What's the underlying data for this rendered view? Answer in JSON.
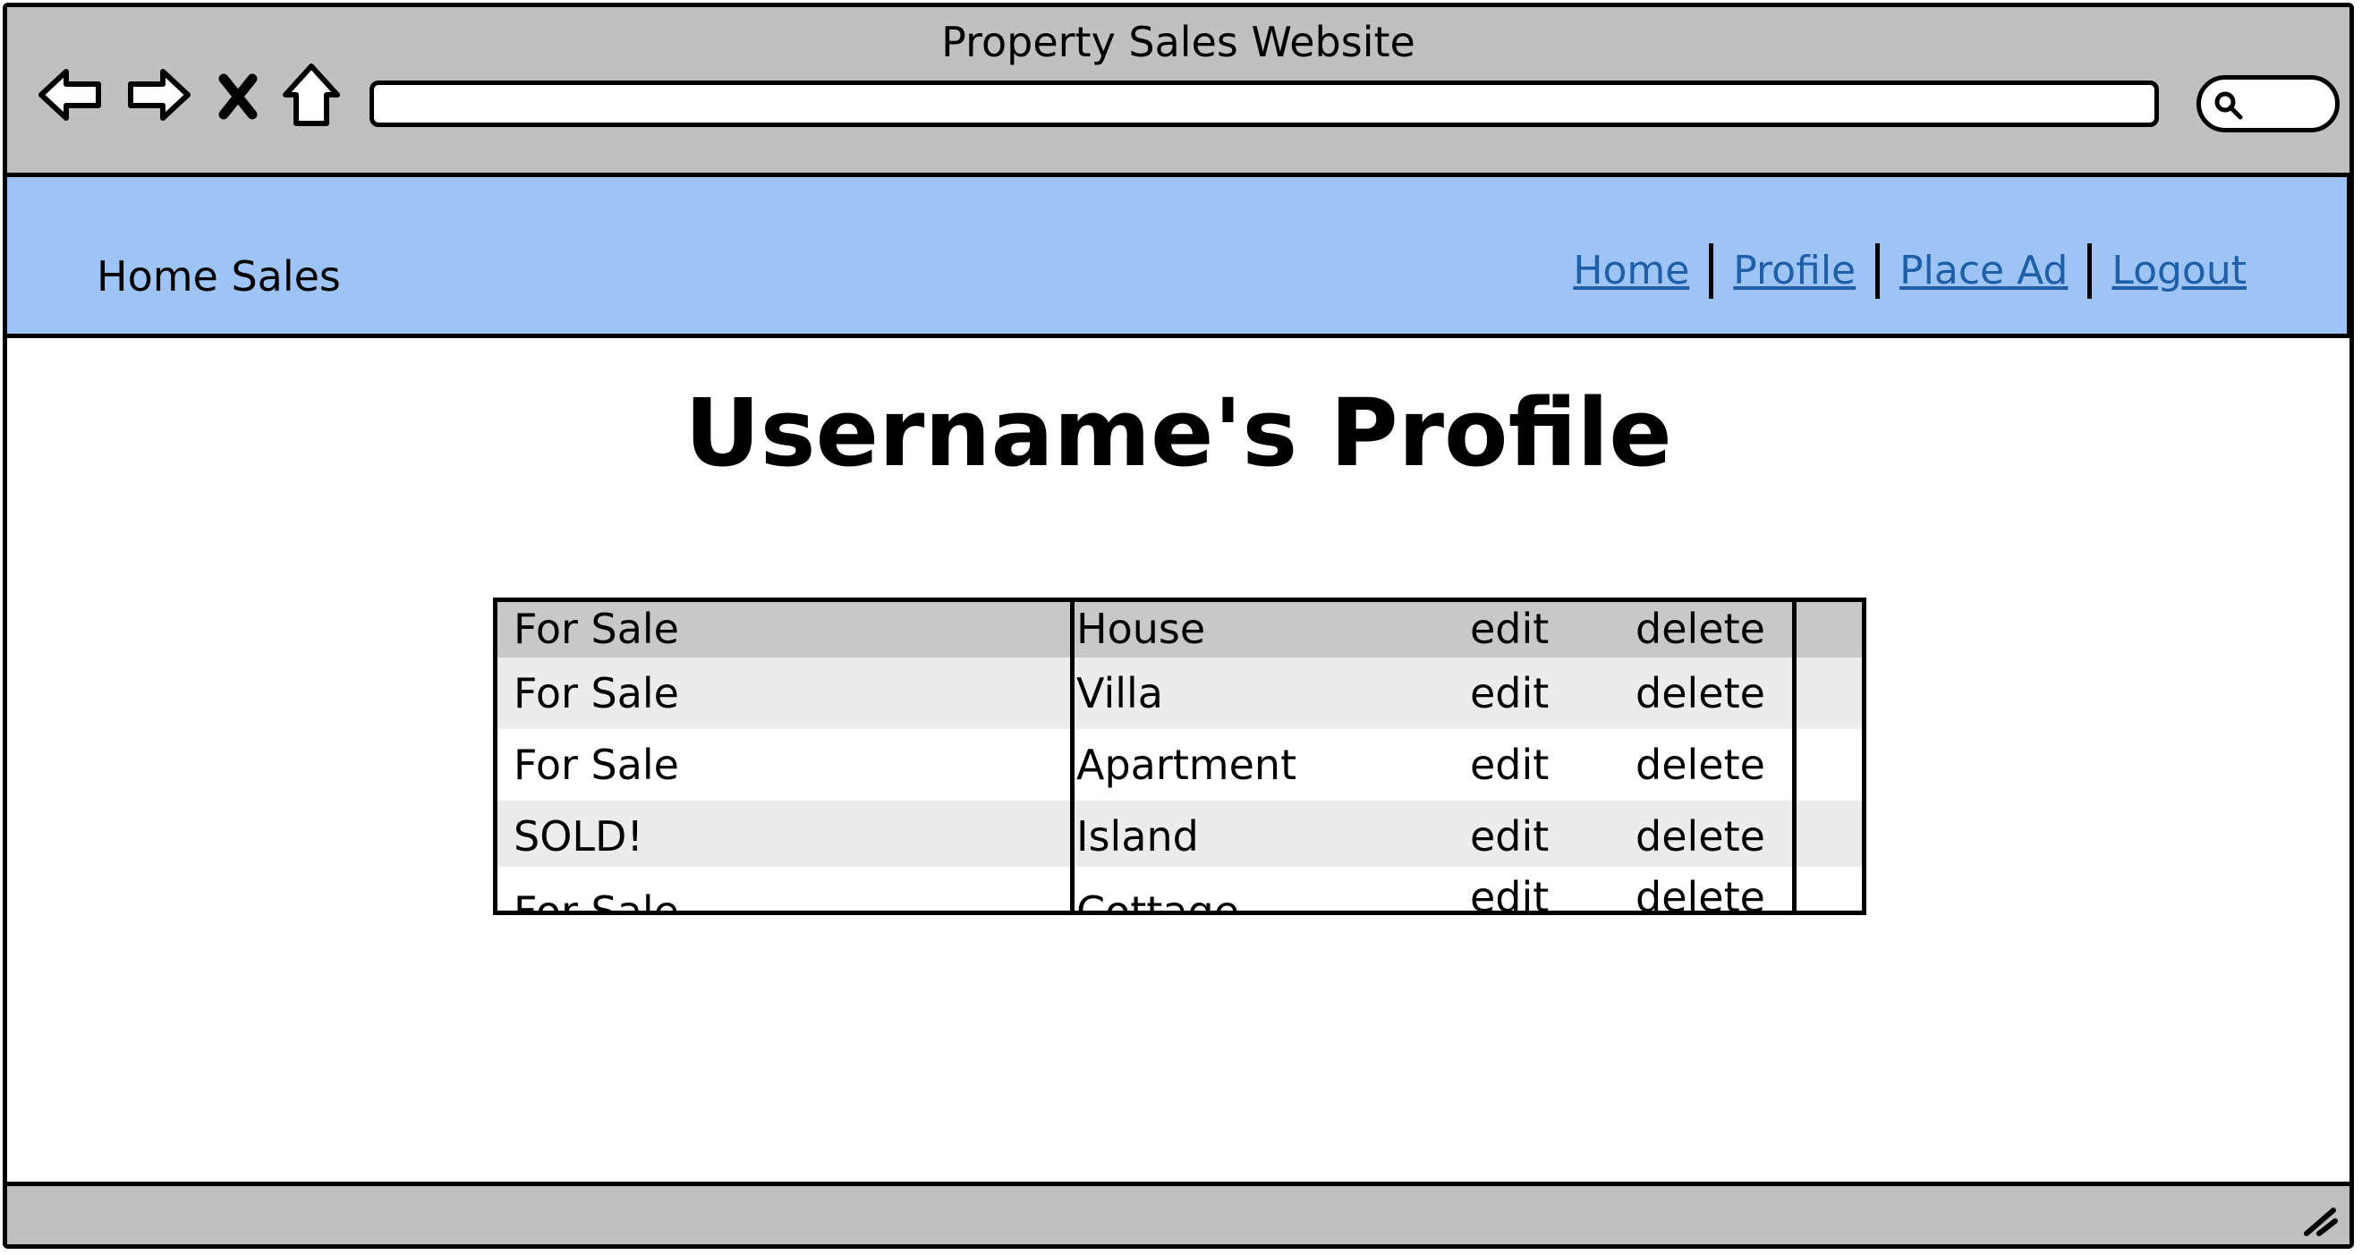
{
  "window": {
    "title": "Property Sales Website"
  },
  "toolbar": {
    "icons": [
      "back-arrow-icon",
      "forward-arrow-icon",
      "close-icon",
      "home-icon",
      "search-icon"
    ],
    "url_value": ""
  },
  "header": {
    "site_name": "Home Sales",
    "background": "#9ec3f5",
    "link_color": "#1f5fa8",
    "nav": [
      {
        "label": "Home"
      },
      {
        "label": "Profile"
      },
      {
        "label": "Place Ad"
      },
      {
        "label": "Logout"
      }
    ]
  },
  "main": {
    "title": "Username's Profile",
    "listings": [
      {
        "status": "For Sale",
        "type": "House",
        "edit": "edit",
        "delete": "delete"
      },
      {
        "status": "For Sale",
        "type": "Villa",
        "edit": "edit",
        "delete": "delete"
      },
      {
        "status": "For Sale",
        "type": "Apartment",
        "edit": "edit",
        "delete": "delete"
      },
      {
        "status": "SOLD!",
        "type": "Island",
        "edit": "edit",
        "delete": "delete"
      },
      {
        "status": "For Sale",
        "type": "Cottage",
        "edit": "edit",
        "delete": "delete"
      }
    ],
    "row_colors": [
      "#c8c8c8",
      "#ececec",
      "#ffffff",
      "#ececec",
      "#ffffff"
    ]
  }
}
